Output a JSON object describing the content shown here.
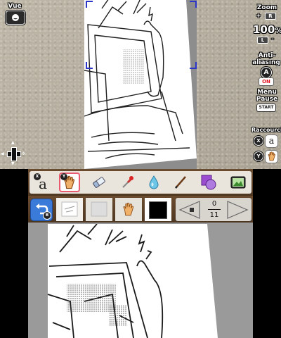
{
  "top_screen": {
    "view": {
      "label": "Vue"
    },
    "zoom": {
      "label": "Zoom",
      "zoom_in_symbol": "+",
      "zoom_in_key": "R",
      "value": "100",
      "unit": "%",
      "zoom_out_key": "L",
      "zoom_out_symbol": "-"
    },
    "antialiasing": {
      "label_line1": "Anti-",
      "label_line2": "aliasing",
      "button": "A",
      "state": "ON"
    },
    "pause_menu": {
      "label_line1": "Menu",
      "label_line2": "Pause",
      "button": "START"
    },
    "shortcuts": {
      "label": "Raccourci",
      "items": [
        {
          "key": "X",
          "tool_char": "a",
          "icon": "text-tool-icon"
        },
        {
          "key": "Y",
          "tool_char": "",
          "icon": "hand-tool-icon"
        }
      ]
    }
  },
  "bottom_screen": {
    "tools": [
      {
        "name": "text",
        "char": "a",
        "badge": "X",
        "icon": "text-tool-icon"
      },
      {
        "name": "hand",
        "badge": "Y",
        "icon": "hand-tool-icon",
        "selected": true
      },
      {
        "name": "eraser",
        "icon": "eraser-icon"
      },
      {
        "name": "eyedropper",
        "icon": "eyedropper-icon"
      },
      {
        "name": "water",
        "icon": "water-drop-icon"
      },
      {
        "name": "pen",
        "icon": "pen-icon"
      },
      {
        "name": "shapes",
        "icon": "shapes-icon"
      },
      {
        "name": "screenshot",
        "icon": "camera-icon"
      }
    ],
    "undo": {
      "badge": "B",
      "icon": "undo-icon"
    },
    "current_color": "#000000",
    "page": {
      "current": "0",
      "total": "11"
    }
  },
  "colors": {
    "accent": "#3a7ad8",
    "toolbar_wood": "#5a4027",
    "selection": "#e85a6e",
    "corner_marker": "#2b35c8",
    "on_text": "#e0141e"
  }
}
